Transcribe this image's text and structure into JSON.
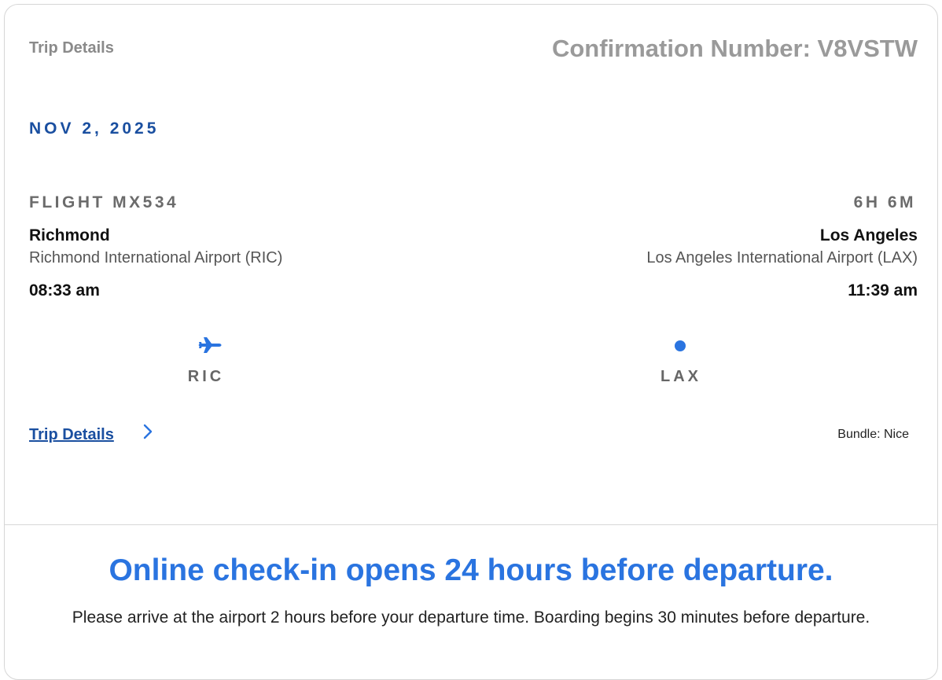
{
  "header": {
    "trip_label": "Trip Details",
    "confirmation": "Confirmation Number: V8VSTW"
  },
  "date": "NOV 2, 2025",
  "flight": {
    "number_label": "FLIGHT MX534",
    "duration": "6H 6M",
    "origin": {
      "city": "Richmond",
      "airport": "Richmond International Airport (RIC)",
      "time": "08:33 am",
      "code": "RIC"
    },
    "destination": {
      "city": "Los Angeles",
      "airport": "Los Angeles International Airport (LAX)",
      "time": "11:39 am",
      "code": "LAX"
    }
  },
  "links": {
    "trip_details": "Trip Details"
  },
  "bundle": "Bundle: Nice",
  "checkin": {
    "title": "Online check-in opens 24 hours before departure.",
    "body": "Please arrive at the airport 2 hours before your departure time. Boarding begins 30 minutes before departure."
  },
  "icons": {
    "origin": "plane-icon",
    "destination": "destination-dot-icon",
    "link": "chevron-right-icon"
  },
  "colors": {
    "accent_blue": "#2a74e0",
    "dark_blue": "#1a4fa0",
    "muted_gray": "#8a8a8a"
  }
}
